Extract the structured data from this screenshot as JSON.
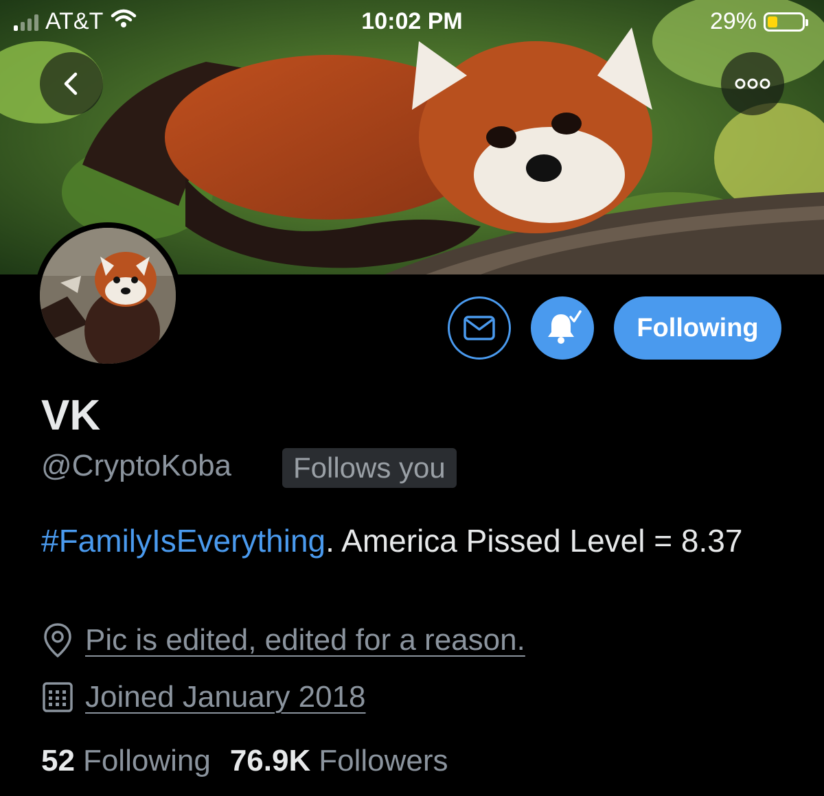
{
  "status_bar": {
    "carrier": "AT&T",
    "time": "10:02 PM",
    "battery_percent": "29%",
    "battery_level": 0.29,
    "battery_color": "#ffd60a",
    "signal_bars": 1,
    "icons": [
      "signal-icon",
      "wifi-icon",
      "battery-icon"
    ]
  },
  "header": {
    "back_icon": "chevron-left-icon",
    "more_icon": "ellipsis-icon"
  },
  "profile": {
    "name": "VK",
    "handle": "@CryptoKoba",
    "follows_you": "Follows you",
    "bio_hashtag": "#FamilyIsEverything",
    "bio_rest": ". America Pissed Level = 8.37",
    "location": "Pic is edited, edited for a reason.",
    "joined": "Joined January 2018",
    "following_count": "52",
    "following_label": "Following",
    "followers_count": "76.9K",
    "followers_label": "Followers"
  },
  "actions": {
    "message_icon": "envelope-icon",
    "notify_icon": "bell-check-icon",
    "follow_button_label": "Following"
  },
  "colors": {
    "accent": "#4a9aee",
    "background": "#000000",
    "secondary_text": "#8b949e"
  }
}
